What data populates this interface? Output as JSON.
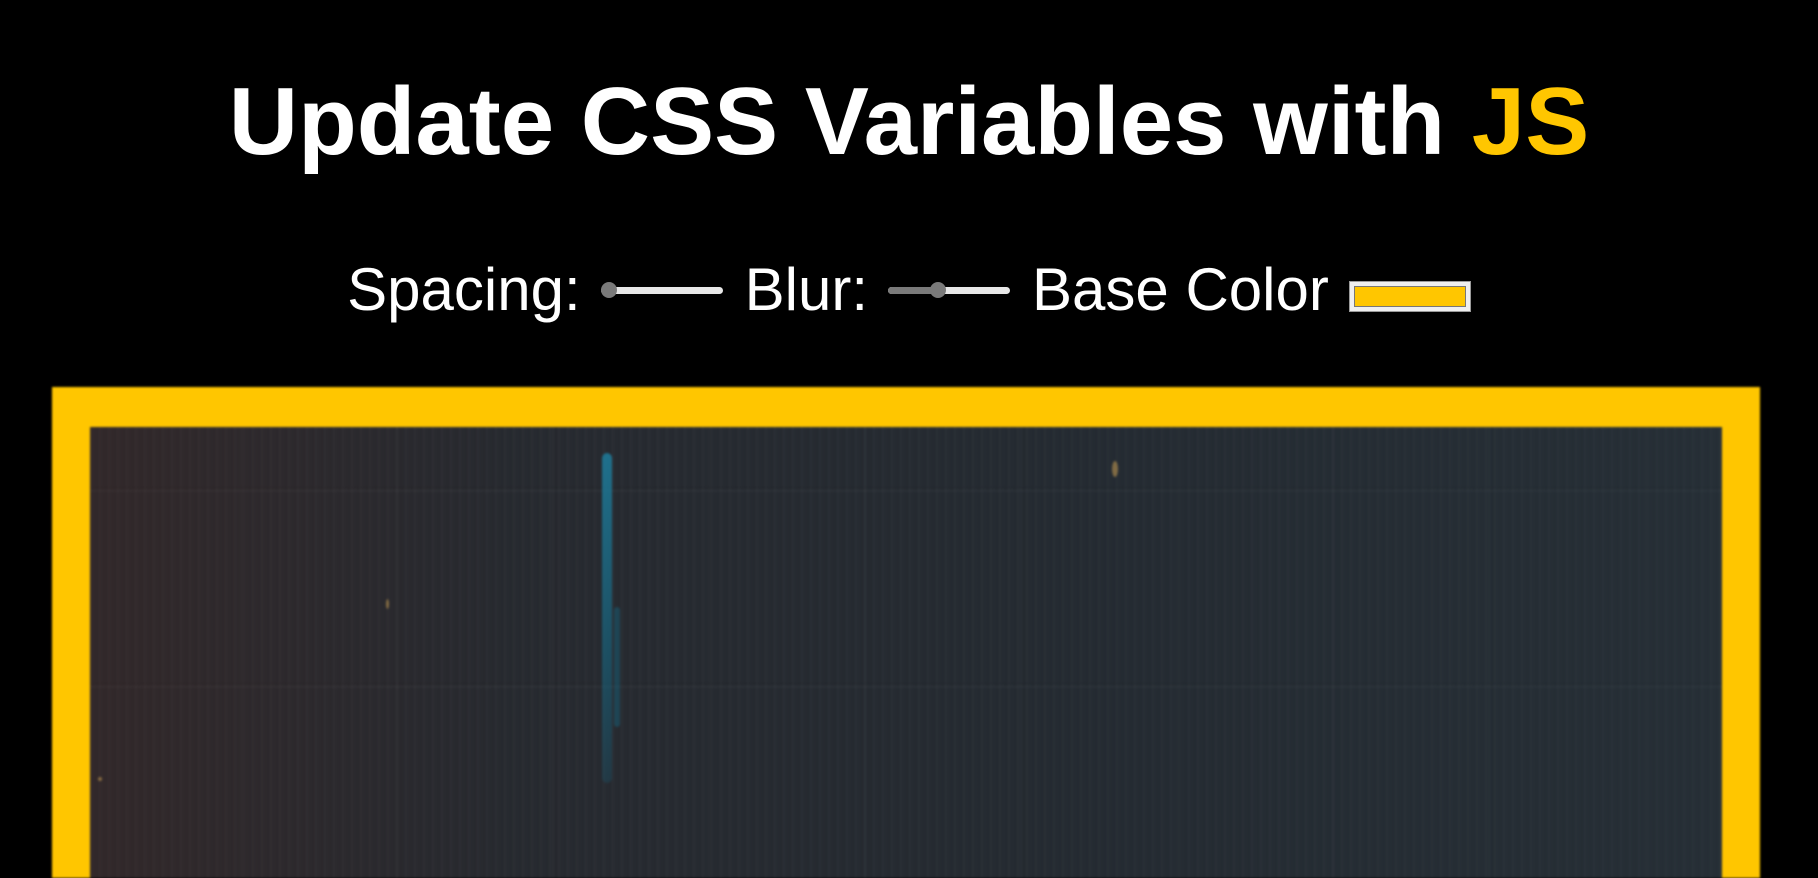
{
  "header": {
    "title_main": "Update CSS Variables with",
    "title_highlight": "JS"
  },
  "controls": {
    "spacing": {
      "label": "Spacing:",
      "value": 10,
      "min": 10,
      "max": 200
    },
    "blur": {
      "label": "Blur:",
      "value": 10,
      "min": 0,
      "max": 25
    },
    "base_color": {
      "label": "Base Color",
      "value": "#ffc600"
    }
  },
  "colors": {
    "background": "#000000",
    "text": "#ffffff",
    "accent": "#ffc600"
  }
}
